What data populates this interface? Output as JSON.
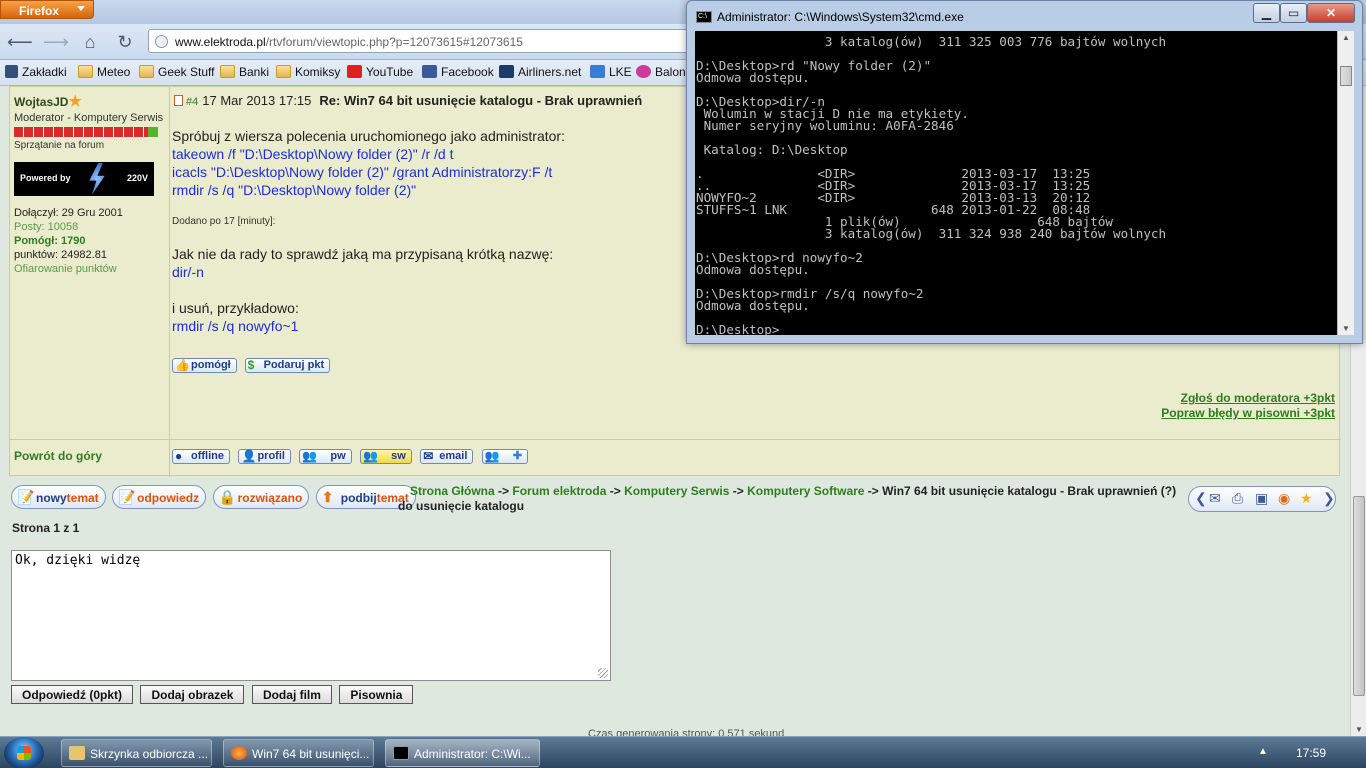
{
  "browser": {
    "menu_button": "Firefox",
    "url_domain": "www.elektroda.pl",
    "url_path": "/rtvforum/viewtopic.php?p=12073615#12073615",
    "bookmarks": [
      "Zakładki",
      "Meteo",
      "Geek Stuff",
      "Banki",
      "Komiksy",
      "YouTube",
      "Facebook",
      "Airliners.net",
      "LKE",
      "Balon"
    ]
  },
  "post": {
    "author": {
      "name": "WojtasJD",
      "rank": "Moderator - Komputery Serwis",
      "subrank": "Sprzątanie na forum",
      "powered_label": "Powered by",
      "powered_volt": "220V",
      "joined": "Dołączył: 29 Gru 2001",
      "posts": "Posty: 10058",
      "helped": "Pomógł: 1790",
      "points": "punktów: 24982.81",
      "donate": "Ofiarowanie punktów"
    },
    "number": "#4",
    "date": "17 Mar 2013 17:15",
    "title": "Re: Win7 64 bit usunięcie katalogu - Brak uprawnień",
    "body": {
      "intro": "Spróbuj z wiersza polecenia uruchomionego jako administrator:",
      "cmd1": "takeown /f \"D:\\Desktop\\Nowy folder (2)\" /r /d t",
      "cmd2": "icacls \"D:\\Desktop\\Nowy folder (2)\" /grant Administratorzy:F /t",
      "cmd3": "rmdir /s /q \"D:\\Desktop\\Nowy folder (2)\"",
      "added": "Dodano po 17 [minuty]:",
      "para2": "Jak nie da rady to sprawdź jaką ma przypisaną krótką nazwę:",
      "cmd4": "dir/-n",
      "para3": "i usuń, przykładowo:",
      "cmd5": "rmdir /s /q nowyfo~1"
    },
    "buttons": {
      "helped": "pomógł",
      "donate": "Podaruj pkt"
    },
    "report": "Zgłoś do moderatora +3pkt",
    "fix_typos": "Popraw błędy w pisowni +3pkt",
    "back_to_top": "Powrót do góry",
    "footer_buttons": [
      "offline",
      "profil",
      "pw",
      "sw",
      "email"
    ]
  },
  "actions": {
    "new_topic": [
      "nowy",
      "temat"
    ],
    "reply": "odpowiedz",
    "solved": "rozwiązano",
    "bump": [
      "podbij",
      "temat"
    ]
  },
  "breadcrumb": {
    "home": "Strona Główna",
    "forum": "Forum elektroda",
    "cat1": "Komputery Serwis",
    "cat2": "Komputery Software",
    "sep": " -> ",
    "current": "Win7 64 bit usunięcie katalogu - Brak uprawnień (?) do usunięcie katalogu"
  },
  "page_counter": "Strona 1 z 1",
  "reply_text": "Ok, dzięki widzę",
  "submit_buttons": [
    "Odpowiedź (0pkt)",
    "Dodaj obrazek",
    "Dodaj film",
    "Pisownia"
  ],
  "bottom_partial": "Czas generowania strony: 0.571 sekund",
  "cmd": {
    "title": "Administrator: C:\\Windows\\System32\\cmd.exe",
    "output": "                 3 katalog(ów)  311 325 003 776 bajtów wolnych\n\nD:\\Desktop>rd \"Nowy folder (2)\"\nOdmowa dostępu.\n\nD:\\Desktop>dir/-n\n Wolumin w stacji D nie ma etykiety.\n Numer seryjny woluminu: A0FA-2846\n\n Katalog: D:\\Desktop\n\n.               <DIR>              2013-03-17  13:25\n..              <DIR>              2013-03-17  13:25\nNOWYFO~2        <DIR>              2013-03-13  20:12\nSTUFFS~1 LNK                   648 2013-01-22  08:48\n                 1 plik(ów)                  648 bajtów\n                 3 katalog(ów)  311 324 938 240 bajtów wolnych\n\nD:\\Desktop>rd nowyfo~2\nOdmowa dostępu.\n\nD:\\Desktop>rmdir /s/q nowyfo~2\nOdmowa dostępu.\n\nD:\\Desktop>"
  },
  "taskbar": {
    "items": [
      "Skrzynka odbiorcza ...",
      "Win7 64 bit usunięci...",
      "Administrator: C:\\Wi..."
    ],
    "time": "17:59"
  }
}
